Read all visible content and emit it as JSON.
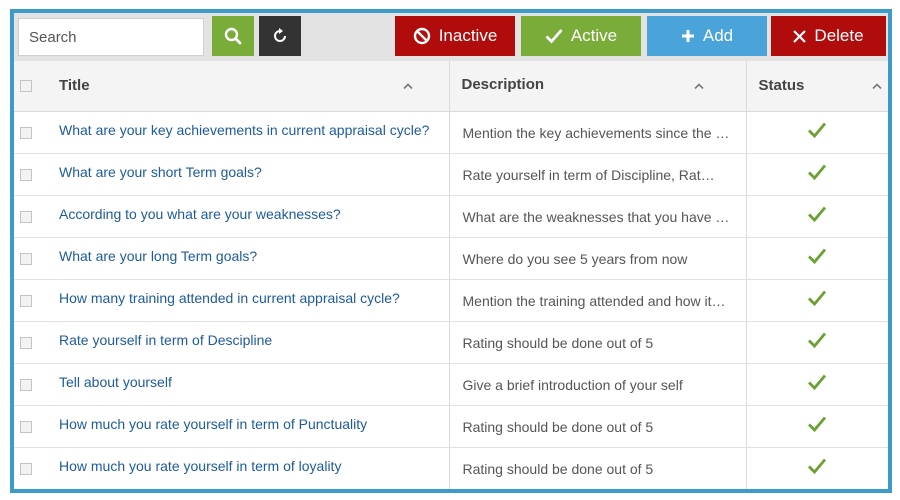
{
  "toolbar": {
    "search_placeholder": "Search",
    "search_icon": "search-icon",
    "refresh_icon": "refresh-icon",
    "inactive_label": "Inactive",
    "active_label": "Active",
    "add_label": "Add",
    "delete_label": "Delete"
  },
  "colors": {
    "frame": "#3d9bc9",
    "green": "#7aac3a",
    "red": "#b00c0c",
    "blue": "#4aa3d9",
    "dark": "#333333",
    "link": "#1c5b9e"
  },
  "table": {
    "headers": {
      "title": "Title",
      "description": "Description",
      "status": "Status"
    },
    "rows": [
      {
        "title": "What are your key achievements in current appraisal cycle?",
        "description": "Mention the key achievements since the …",
        "status": "active"
      },
      {
        "title": "What are your short Term goals?",
        "description": "Rate yourself in term of Discipline, Rat…",
        "status": "active"
      },
      {
        "title": "According to you what are your weaknesses?",
        "description": "What are the weaknesses that you have …",
        "status": "active"
      },
      {
        "title": "What are your long Term goals?",
        "description": "Where do you see 5 years from now",
        "status": "active"
      },
      {
        "title": "How many training attended in current appraisal cycle?",
        "description": "Mention the training attended and how it…",
        "status": "active"
      },
      {
        "title": "Rate yourself in term of Descipline",
        "description": "Rating should be done out of 5",
        "status": "active"
      },
      {
        "title": "Tell about yourself",
        "description": "Give a brief introduction of your self",
        "status": "active"
      },
      {
        "title": "How much you rate yourself in term of Punctuality",
        "description": "Rating should be done out of 5",
        "status": "active"
      },
      {
        "title": "How much you rate yourself in term of loyality",
        "description": "Rating should be done out of 5",
        "status": "active"
      }
    ]
  }
}
